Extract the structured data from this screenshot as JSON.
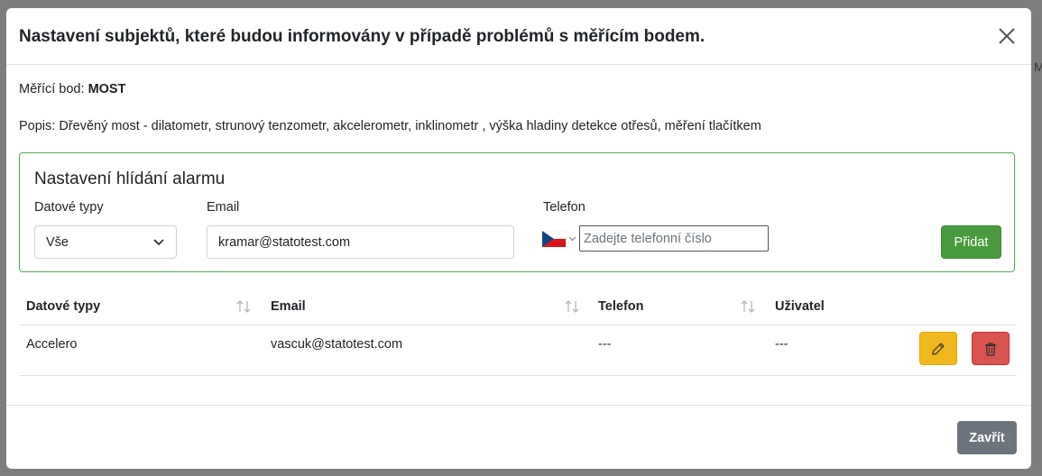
{
  "modal": {
    "title": "Nastavení subjektů, které budou informovány v případě problémů s měřícím bodem.",
    "point_label": "Měřící bod: ",
    "point_value": "MOST",
    "description": "Popis: Dřevěný most - dilatometr, strunový tenzometr, akcelerometr, inklinometr , výška hladiny detekce otřesů, měření tlačítkem"
  },
  "alarm_form": {
    "title": "Nastavení hlídání alarmu",
    "data_types_label": "Datové typy",
    "data_types_value": "Vše",
    "email_label": "Email",
    "email_value": "kramar@statotest.com",
    "phone_label": "Telefon",
    "phone_placeholder": "Zadejte telefonní číslo",
    "phone_country_icon": "czech-flag-icon",
    "add_label": "Přidat"
  },
  "table": {
    "headers": [
      "Datové typy",
      "Email",
      "Telefon",
      "Uživatel"
    ],
    "rows": [
      {
        "data_types": "Accelero",
        "email": "vascuk@statotest.com",
        "phone": "---",
        "user": "---"
      }
    ]
  },
  "footer": {
    "close_label": "Zavřít"
  },
  "colors": {
    "add_button": "#4a9b3f",
    "edit_button": "#f0b81f",
    "delete_button": "#d9534f",
    "close_button": "#6c757d",
    "alarm_border": "#4caf50"
  }
}
